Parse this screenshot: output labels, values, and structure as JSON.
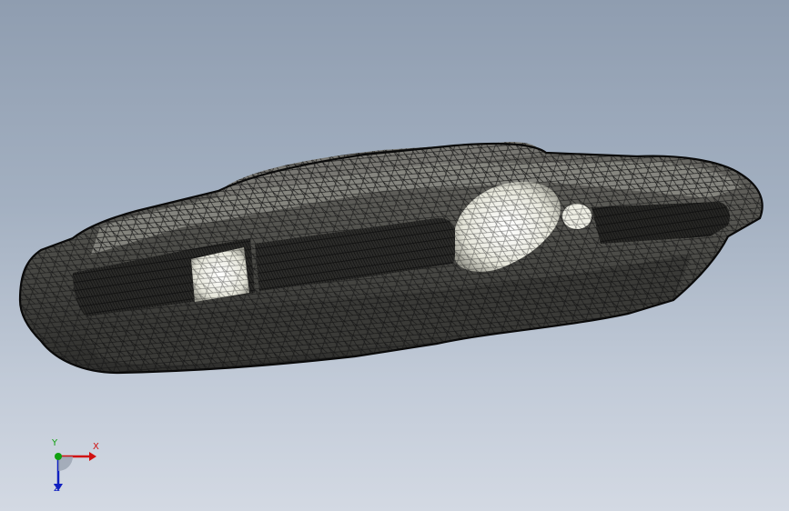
{
  "viewport": {
    "background_top": "#8f9db0",
    "background_bottom": "#d3d9e3",
    "model": {
      "name": "headlamp-mesh",
      "display": "wireframe-shaded",
      "edge_color": "#1a1a1a",
      "face_color": "#5a5a55",
      "highlight_color": "#f2f2ea"
    }
  },
  "triad": {
    "x_label": "X",
    "y_label": "Y",
    "z_label": "Z",
    "x_color": "#d01010",
    "y_color": "#10a010",
    "z_color": "#1020c0"
  }
}
